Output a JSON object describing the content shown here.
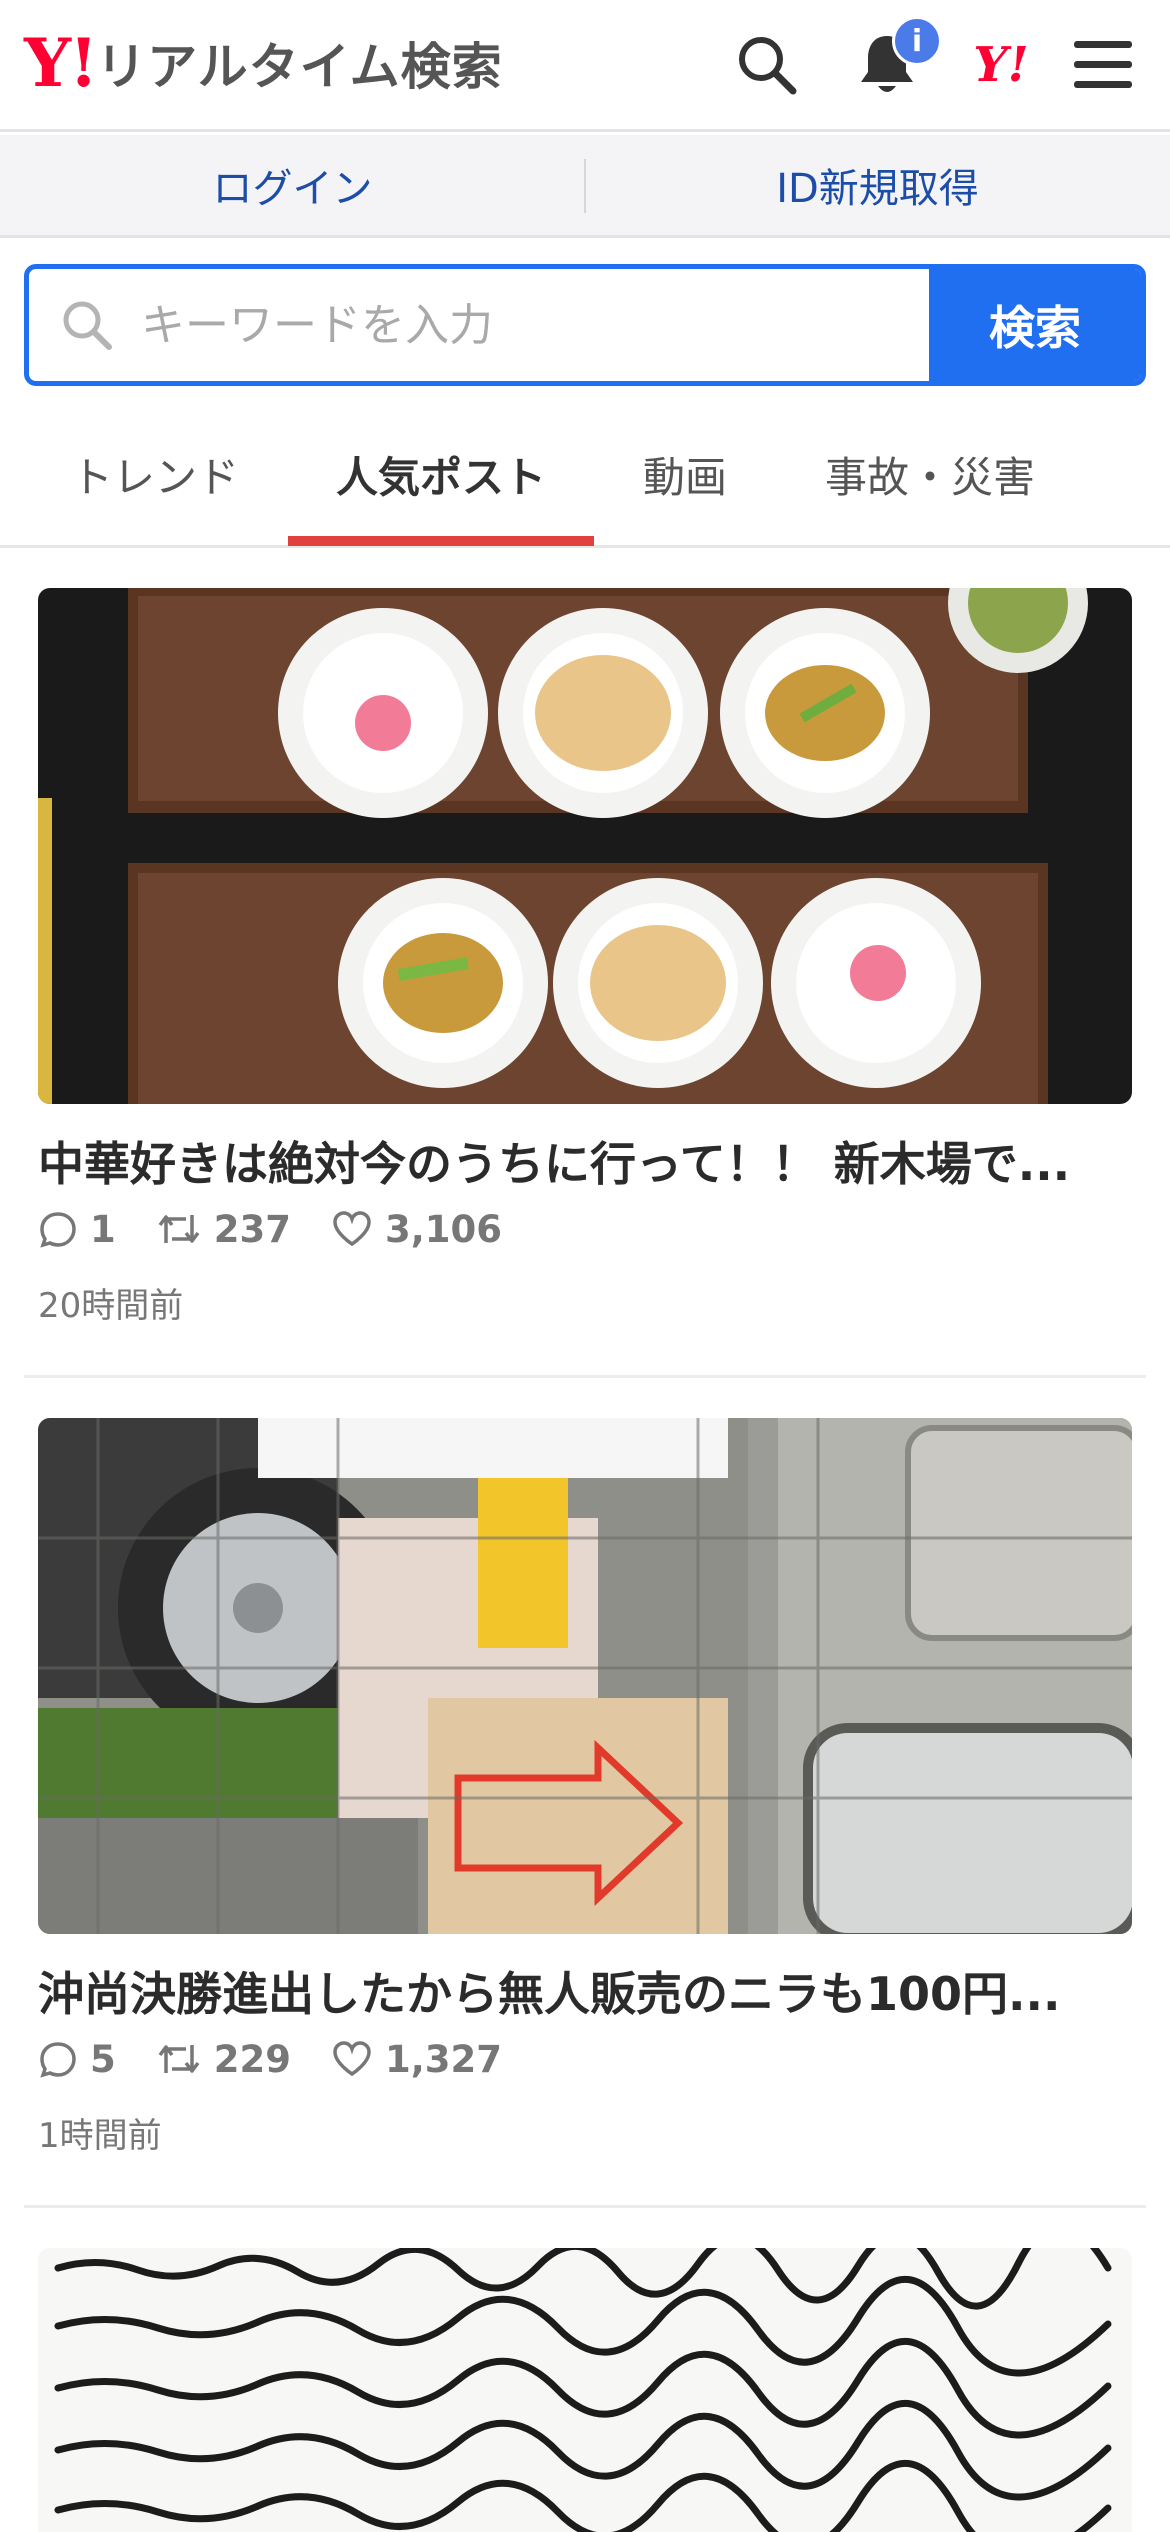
{
  "header": {
    "logo_mark": "Y!",
    "logo_text": "リアルタイム検索",
    "notification_count": "i",
    "yj_mark": "Y!"
  },
  "login_bar": {
    "login": "ログイン",
    "register": "ID新規取得"
  },
  "search": {
    "placeholder": "キーワードを入力",
    "button": "検索"
  },
  "tabs": [
    {
      "label": "トレンド",
      "active": false
    },
    {
      "label": "人気ポスト",
      "active": true
    },
    {
      "label": "動画",
      "active": false
    },
    {
      "label": "事故・災害",
      "active": false
    }
  ],
  "posts": [
    {
      "title": "中華好きは絶対今のうちに行って！！ 新木場で...",
      "replies": "1",
      "reposts": "237",
      "likes": "3,106",
      "time": "20時間前"
    },
    {
      "title": "沖尚決勝進出したから無人販売のニラも100円...",
      "replies": "5",
      "reposts": "229",
      "likes": "1,327",
      "time": "1時間前"
    },
    {
      "title": "",
      "replies": "",
      "reposts": "",
      "likes": "",
      "time": ""
    }
  ],
  "colors": {
    "brand_red": "#ff0033",
    "accent_blue": "#1f6ff0",
    "link_blue": "#1c4ea9",
    "tab_underline": "#e0413e"
  }
}
